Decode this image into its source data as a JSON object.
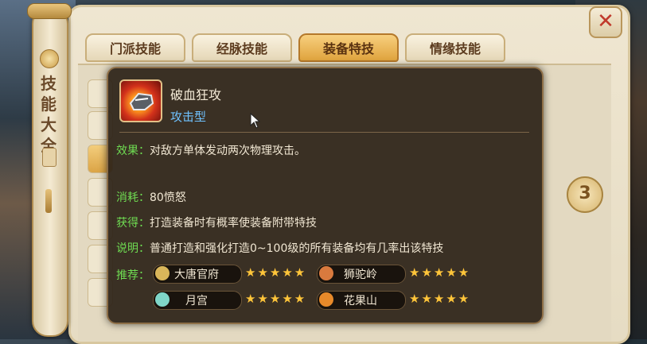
{
  "window": {
    "side_title": "技能大全",
    "close_label": "✕"
  },
  "tabs": [
    {
      "label": "门派技能",
      "active": false
    },
    {
      "label": "经脉技能",
      "active": false
    },
    {
      "label": "装备特技",
      "active": true
    },
    {
      "label": "情缘技能",
      "active": false
    }
  ],
  "side_button_label": "3",
  "skill": {
    "name": "破血狂攻",
    "type": "攻击型",
    "effect_label": "效果：",
    "effect_text": "对敌方单体发动两次物理攻击。",
    "cost_label": "消耗：",
    "cost_text": "80愤怒",
    "obtain_label": "获得：",
    "obtain_text": "打造装备时有概率使装备附带特技",
    "note_label": "说明：",
    "note_text": "普通打造和强化打造0~100级的所有装备均有几率出该特技",
    "recommend_label": "推荐：",
    "recommend": [
      {
        "name": "大唐官府",
        "stars": "★★★★★",
        "icon_color": "#d9b65a"
      },
      {
        "name": "狮驼岭",
        "stars": "★★★★★",
        "icon_color": "#d97a3e"
      },
      {
        "name": "月宫",
        "stars": "★★★★★",
        "icon_color": "#7fd6c8"
      },
      {
        "name": "花果山",
        "stars": "★★★★★",
        "icon_color": "#e88a2a"
      }
    ]
  },
  "colors": {
    "label_green": "#6fdc52",
    "type_blue": "#6fc2ff",
    "star_gold": "#ffc53a",
    "tab_active": "#e0a43e"
  }
}
